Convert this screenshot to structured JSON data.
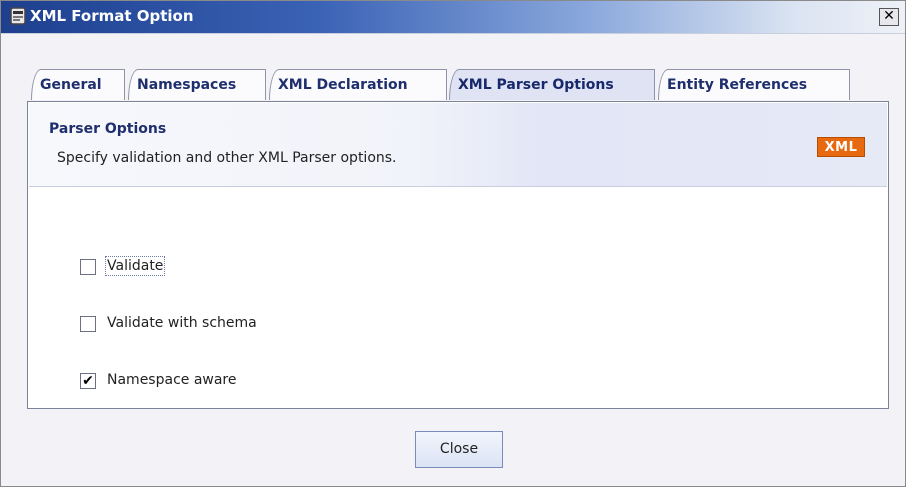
{
  "window": {
    "title": "XML Format Option",
    "close_glyph": "✕"
  },
  "icons": {
    "app": "document-icon",
    "close": "close-icon"
  },
  "tabs": [
    {
      "label": "General",
      "active": false
    },
    {
      "label": "Namespaces",
      "active": false
    },
    {
      "label": "XML Declaration",
      "active": false
    },
    {
      "label": "XML Parser Options",
      "active": true
    },
    {
      "label": "Entity References",
      "active": false
    }
  ],
  "panel": {
    "title": "Parser Options",
    "description": "Specify validation and other XML Parser options.",
    "badge": "XML"
  },
  "options": [
    {
      "label": "Validate",
      "checked": false,
      "focused": true
    },
    {
      "label": "Validate with schema",
      "checked": false,
      "focused": false
    },
    {
      "label": "Namespace aware",
      "checked": true,
      "focused": false
    }
  ],
  "check_glyph": "✔",
  "buttons": {
    "close": "Close"
  },
  "colors": {
    "title_bar_start": "#1d3f8e",
    "badge": "#e86a10"
  }
}
